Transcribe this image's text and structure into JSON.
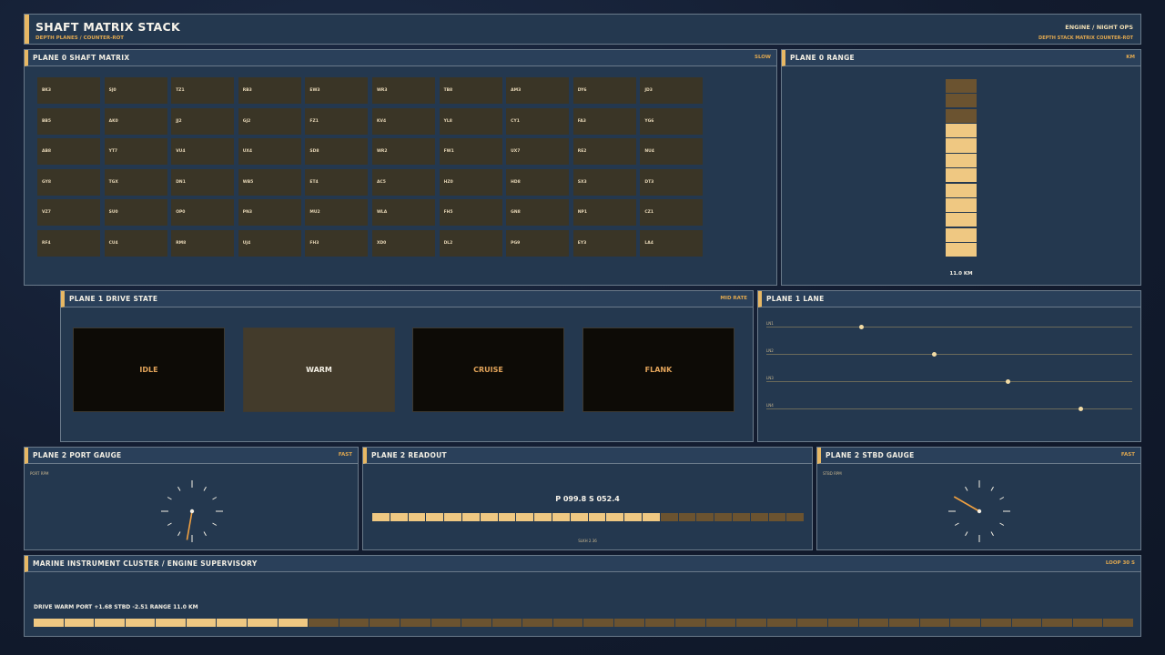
{
  "header": {
    "title": "SHAFT MATRIX STACK",
    "subtitle": "DEPTH PLANES / COUNTER-ROT",
    "mode": "ENGINE / NIGHT OPS",
    "submode": "DEPTH STACK  MATRIX  COUNTER-ROT"
  },
  "matrix": {
    "title": "PLANE 0  SHAFT MATRIX",
    "tag": "SLOW",
    "cells": [
      "BK3",
      "SJ0",
      "TZ1",
      "RB3",
      "EW3",
      "WR3",
      "TB8",
      "AM3",
      "DY6",
      "JD3",
      "BB5",
      "AK0",
      "JJ2",
      "GJ2",
      "FZ1",
      "KV4",
      "YL8",
      "CY1",
      "FA3",
      "YG6",
      "AB8",
      "YT7",
      "VU4",
      "UX4",
      "SD8",
      "WR2",
      "FW1",
      "UX7",
      "RE2",
      "NU4",
      "GY8",
      "TGX",
      "DN1",
      "WB5",
      "ET4",
      "AC5",
      "HZ0",
      "HD8",
      "SX3",
      "DT3",
      "VZ7",
      "SU0",
      "OP0",
      "PN3",
      "MU2",
      "WLA",
      "FH5",
      "GN8",
      "NP1",
      "CZ1",
      "RF4",
      "CU4",
      "RM8",
      "UJ4",
      "FH3",
      "XD0",
      "DL2",
      "PG9",
      "EY3",
      "LA4"
    ]
  },
  "range": {
    "title": "PLANE 0  RANGE",
    "tag": "KM",
    "segments_total": 12,
    "segments_lit": 9,
    "readout": "11.0 KM"
  },
  "drive": {
    "title": "PLANE 1  DRIVE STATE",
    "tag": "MID RATE",
    "states": [
      "IDLE",
      "WARM",
      "CRUISE",
      "FLANK"
    ],
    "active": 1
  },
  "lane": {
    "title": "PLANE 1  LANE",
    "lanes": [
      {
        "label": "LN1",
        "value": 0.26
      },
      {
        "label": "LN2",
        "value": 0.46
      },
      {
        "label": "LN3",
        "value": 0.66
      },
      {
        "label": "LN4",
        "value": 0.86
      }
    ]
  },
  "port": {
    "title": "PLANE 2  PORT GAUGE",
    "tag": "FAST",
    "label": "PORT RPM",
    "needle_deg": 190
  },
  "readout": {
    "title": "PLANE 2  READOUT",
    "text": "P 099.8   S 052.4",
    "foot": "SLKH 2.36",
    "segments_total": 24,
    "segments_lit": 16
  },
  "stbd": {
    "title": "PLANE 2  STBD GAUGE",
    "tag": "FAST",
    "label": "STBD RPM",
    "needle_deg": 300
  },
  "footer": {
    "title": "MARINE INSTRUMENT CLUSTER  /  ENGINE SUPERVISORY",
    "tag": "LOOP 30 S",
    "status": "DRIVE WARM   PORT +1.68   STBD -2.51   RANGE 11.0 KM",
    "segments_total": 36,
    "segments_lit": 9
  },
  "colors": {
    "accent": "#e8b864",
    "lit": "#efc882",
    "unlit": "#6b5330",
    "needle": "#f0a040"
  }
}
